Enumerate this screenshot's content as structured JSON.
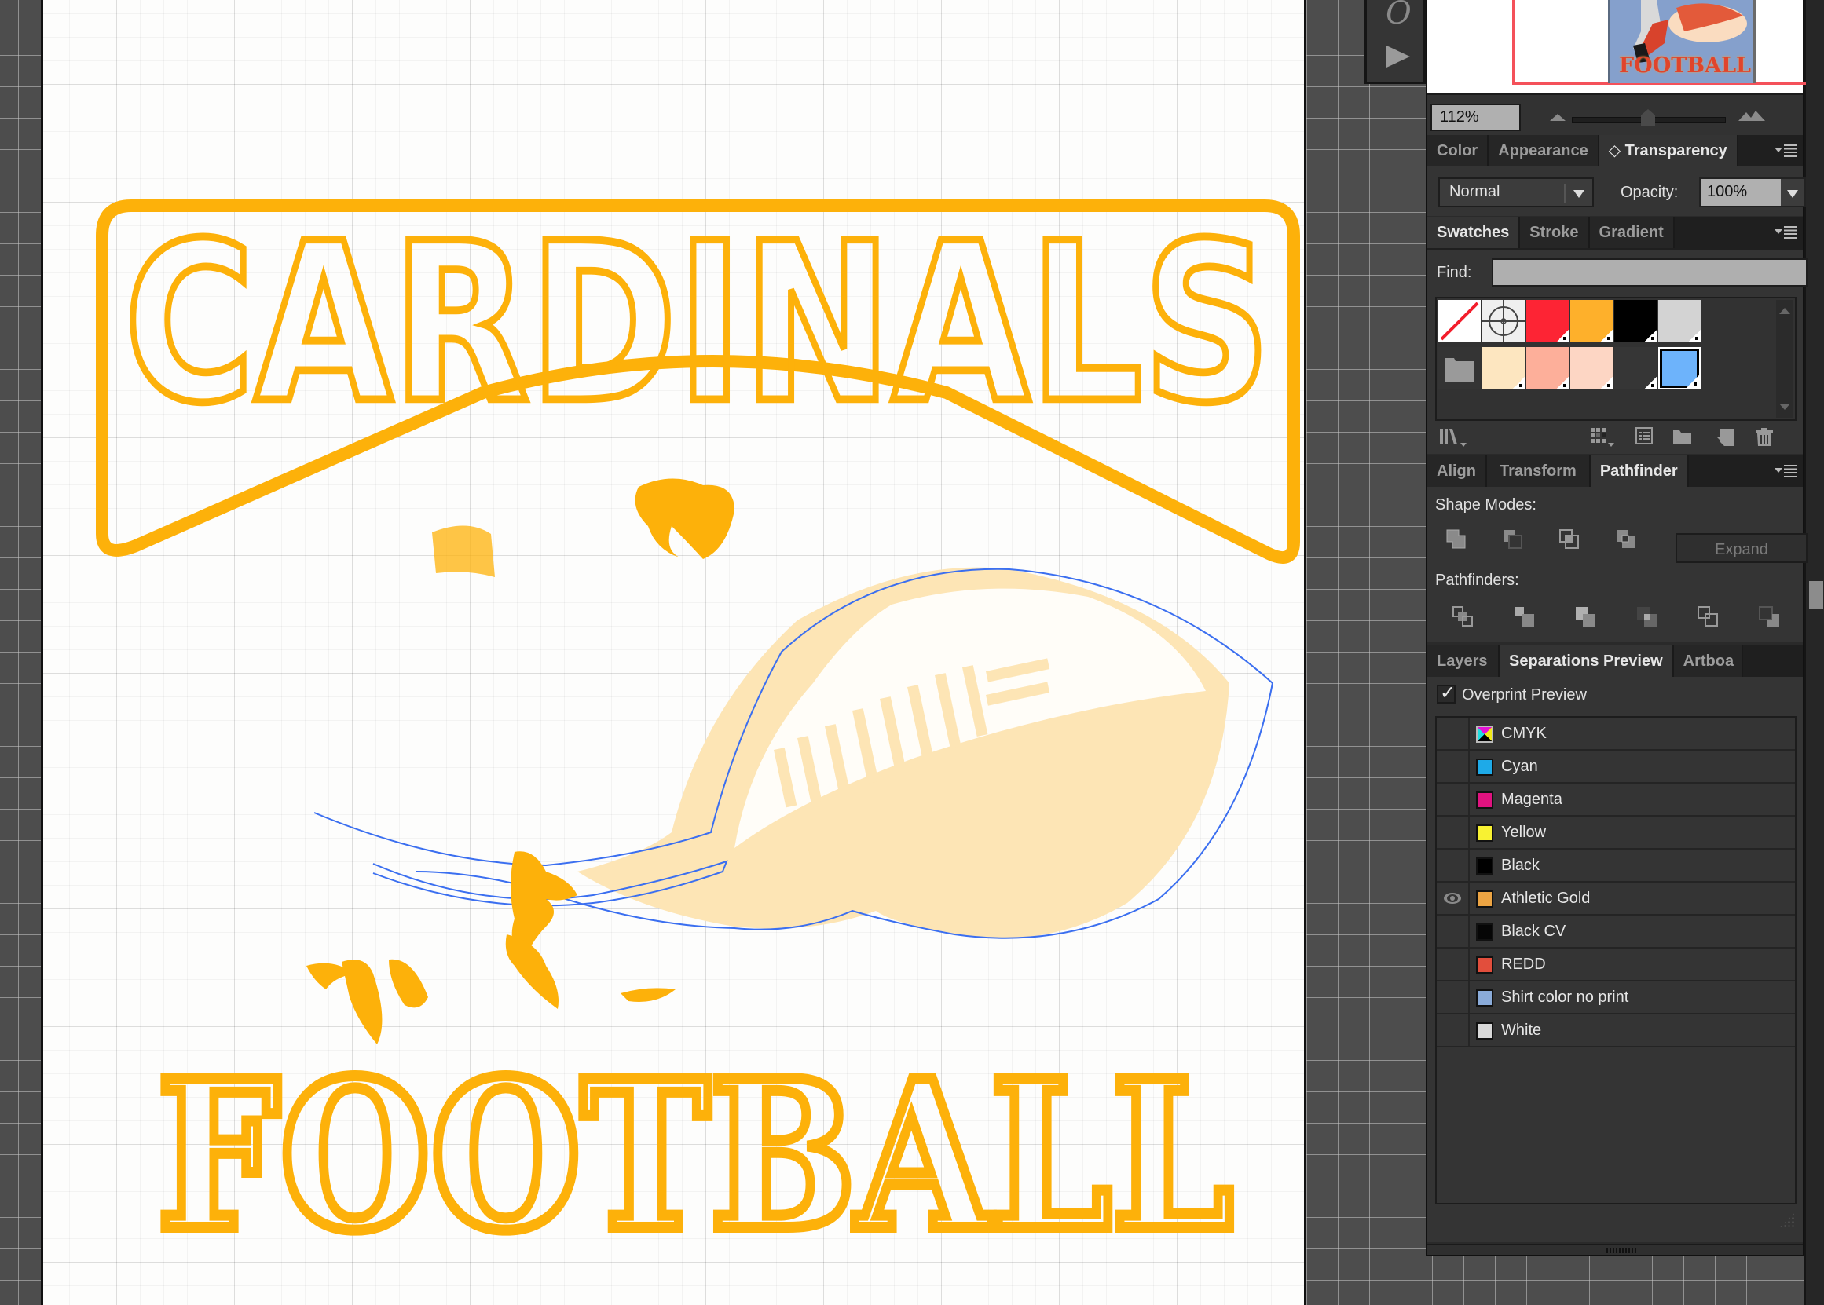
{
  "canvas": {
    "artwork_text_top": "CARDINALS",
    "artwork_text_bottom": "FOOTBALL",
    "ink_color": "#fdb10a",
    "ball_tint": "#fde5b5",
    "selection_color": "#3b6ff0"
  },
  "mini_tools": {
    "glyph": "O",
    "play_icon": "play-icon"
  },
  "navigator": {
    "thumbnail_text": "FOOTBALL",
    "zoom_value": "112%",
    "zoom_level_percent": 112,
    "zoom_slider_fraction": 0.45
  },
  "transparency_panel": {
    "tabs": [
      {
        "label": "Color",
        "active": false
      },
      {
        "label": "Appearance",
        "active": false
      },
      {
        "label": "◇ Transparency",
        "active": true
      }
    ],
    "blend_mode": "Normal",
    "opacity_label": "Opacity:",
    "opacity_value": "100%"
  },
  "swatches_panel": {
    "tabs": [
      {
        "label": "Swatches",
        "active": true
      },
      {
        "label": "Stroke",
        "active": false
      },
      {
        "label": "Gradient",
        "active": false
      }
    ],
    "find_label": "Find:",
    "find_value": "",
    "row1": [
      {
        "name": "none",
        "color": "#ffffff"
      },
      {
        "name": "registration",
        "color": "#efefef"
      },
      {
        "name": "red",
        "color": "#fd2434"
      },
      {
        "name": "athletic-gold",
        "color": "#feb02b"
      },
      {
        "name": "black",
        "color": "#000000"
      },
      {
        "name": "light-gray",
        "color": "#d3d3d3"
      }
    ],
    "row2": [
      {
        "name": "color-group-folder",
        "color": "#343434"
      },
      {
        "name": "cream",
        "color": "#fde6c0"
      },
      {
        "name": "salmon",
        "color": "#fdaf9a"
      },
      {
        "name": "peach",
        "color": "#fdd6c4"
      },
      {
        "name": "dark-gray",
        "color": "#363636"
      },
      {
        "name": "sky-blue",
        "color": "#6db3fb",
        "selected": true
      }
    ]
  },
  "pathfinder_panel": {
    "tabs": [
      {
        "label": "Align",
        "active": false
      },
      {
        "label": "Transform",
        "active": false
      },
      {
        "label": "Pathfinder",
        "active": true
      }
    ],
    "shape_modes_label": "Shape Modes:",
    "expand_label": "Expand",
    "pathfinders_label": "Pathfinders:"
  },
  "separations_panel": {
    "tabs": [
      {
        "label": "Layers",
        "active": false
      },
      {
        "label": "Separations Preview",
        "active": true
      },
      {
        "label": "Artboa",
        "active": false
      }
    ],
    "overprint_label": "Overprint Preview",
    "overprint_checked": true,
    "plates": [
      {
        "name": "CMYK",
        "color": "cmyk",
        "visible": false
      },
      {
        "name": "Cyan",
        "color": "#1eaae8",
        "visible": false
      },
      {
        "name": "Magenta",
        "color": "#e0127f",
        "visible": false
      },
      {
        "name": "Yellow",
        "color": "#f8f232",
        "visible": false
      },
      {
        "name": "Black",
        "color": "#000000",
        "visible": false
      },
      {
        "name": "Athletic Gold",
        "color": "#eca443",
        "visible": true
      },
      {
        "name": "Black CV",
        "color": "#060606",
        "visible": false
      },
      {
        "name": "REDD",
        "color": "#e24e3c",
        "visible": false
      },
      {
        "name": "Shirt color no print",
        "color": "#8aabd9",
        "visible": false
      },
      {
        "name": "White",
        "color": "#d8d8d8",
        "visible": false
      }
    ]
  }
}
